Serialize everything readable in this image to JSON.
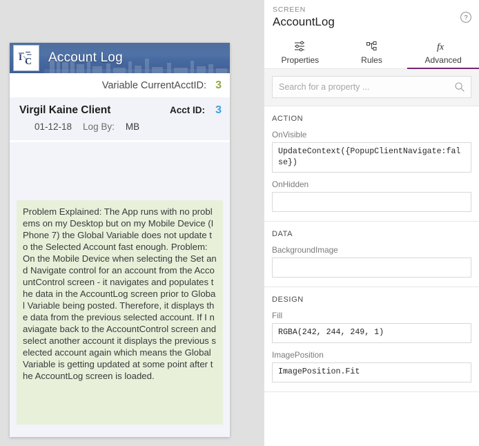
{
  "canvas": {
    "app": {
      "logo_letters": "IC",
      "logo_icon_name": "ic-logo-icon",
      "title": "Account Log",
      "banner_color": "#4a6ea5"
    },
    "variable_row": {
      "label": "Variable CurrentAcctID:",
      "value": "3",
      "value_color": "#8faa3c"
    },
    "record": {
      "client_name": "Virgil Kaine Client",
      "acct_id_label": "Acct ID:",
      "acct_id_value": "3",
      "acct_id_color": "#3aa0dd",
      "log_date": "01-12-18",
      "log_by_label": "Log By:",
      "log_by_value": "MB"
    },
    "problem": {
      "background_color": "#e8f0da",
      "text": "Problem Explained:  The App runs with no problems on my Desktop but on my Mobile Device (IPhone 7) the Global Variable does not update to the Selected Account fast enough. Problem: On the Mobile Device when selecting the Set and Navigate control for an account from the AccountControl screen - it navigates and populates the data in the AccountLog screen prior to Global Variable being posted. Therefore, it displays the data from the previous selected account. If I naviagate back to the AccountControl screen and select another account it displays the previous selected account again which means the Global Variable is getting updated at some point after the AccountLog screen is loaded."
    }
  },
  "panel": {
    "kicker": "SCREEN",
    "screen_name": "AccountLog",
    "help_icon_name": "help-circle-icon",
    "tabs": [
      {
        "label": "Properties",
        "icon": "sliders-icon",
        "selected": false
      },
      {
        "label": "Rules",
        "icon": "rules-tree-icon",
        "selected": false
      },
      {
        "label": "Advanced",
        "icon": "fx-icon",
        "selected": true
      }
    ],
    "selected_tab_color": "#742774",
    "search": {
      "placeholder": "Search for a property ...",
      "value": "",
      "icon": "search-icon"
    },
    "sections": [
      {
        "title": "ACTION",
        "properties": [
          {
            "label": "OnVisible",
            "value": "UpdateContext({PopupClientNavigate:false})"
          },
          {
            "label": "OnHidden",
            "value": ""
          }
        ]
      },
      {
        "title": "DATA",
        "properties": [
          {
            "label": "BackgroundImage",
            "value": ""
          }
        ]
      },
      {
        "title": "DESIGN",
        "properties": [
          {
            "label": "Fill",
            "value": "RGBA(242, 244, 249, 1)"
          },
          {
            "label": "ImagePosition",
            "value": "ImagePosition.Fit"
          }
        ]
      }
    ]
  }
}
